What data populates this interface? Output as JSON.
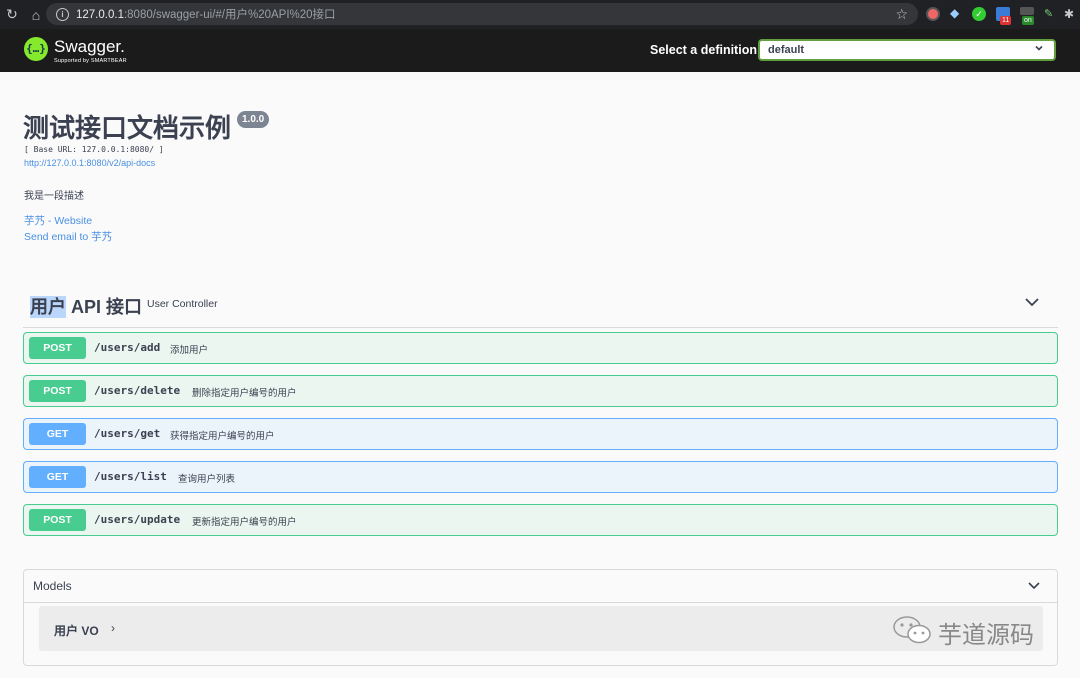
{
  "browser": {
    "url_host": "127.0.0.1",
    "url_rest": ":8080/swagger-ui/#/用户%20API%20接口",
    "ext_badges": [
      "11",
      "on"
    ]
  },
  "topbar": {
    "logo_mark": "{…}",
    "logo_text": "Swagger.",
    "logo_sub": "Supported by SMARTBEAR",
    "select_label": "Select a definition",
    "select_value": "default"
  },
  "info": {
    "title": "测试接口文档示例",
    "version": "1.0.0",
    "base_url": "[ Base URL: 127.0.0.1:8080/ ]",
    "api_docs": "http://127.0.0.1:8080/v2/api-docs",
    "description": "我是一段描述",
    "website_link": "芋艿 - Website",
    "email_link": "Send email to 芋艿"
  },
  "tag": {
    "name_highlight": "用户",
    "name_rest": " API 接口",
    "description": "User Controller"
  },
  "operations": [
    {
      "method": "POST",
      "path": "/users/add",
      "summary": "添加用户"
    },
    {
      "method": "POST",
      "path": "/users/delete",
      "summary": "删除指定用户编号的用户"
    },
    {
      "method": "GET",
      "path": "/users/get",
      "summary": "获得指定用户编号的用户"
    },
    {
      "method": "GET",
      "path": "/users/list",
      "summary": "查询用户列表"
    },
    {
      "method": "POST",
      "path": "/users/update",
      "summary": "更新指定用户编号的用户"
    }
  ],
  "models": {
    "title": "Models",
    "items": [
      {
        "name": "用户 VO"
      }
    ]
  },
  "watermark": "芋道源码",
  "colors": {
    "post": "#49cc90",
    "get": "#61affe",
    "link": "#4990e2",
    "topbar": "#1b1b1b",
    "logo": "#85ea2d"
  }
}
